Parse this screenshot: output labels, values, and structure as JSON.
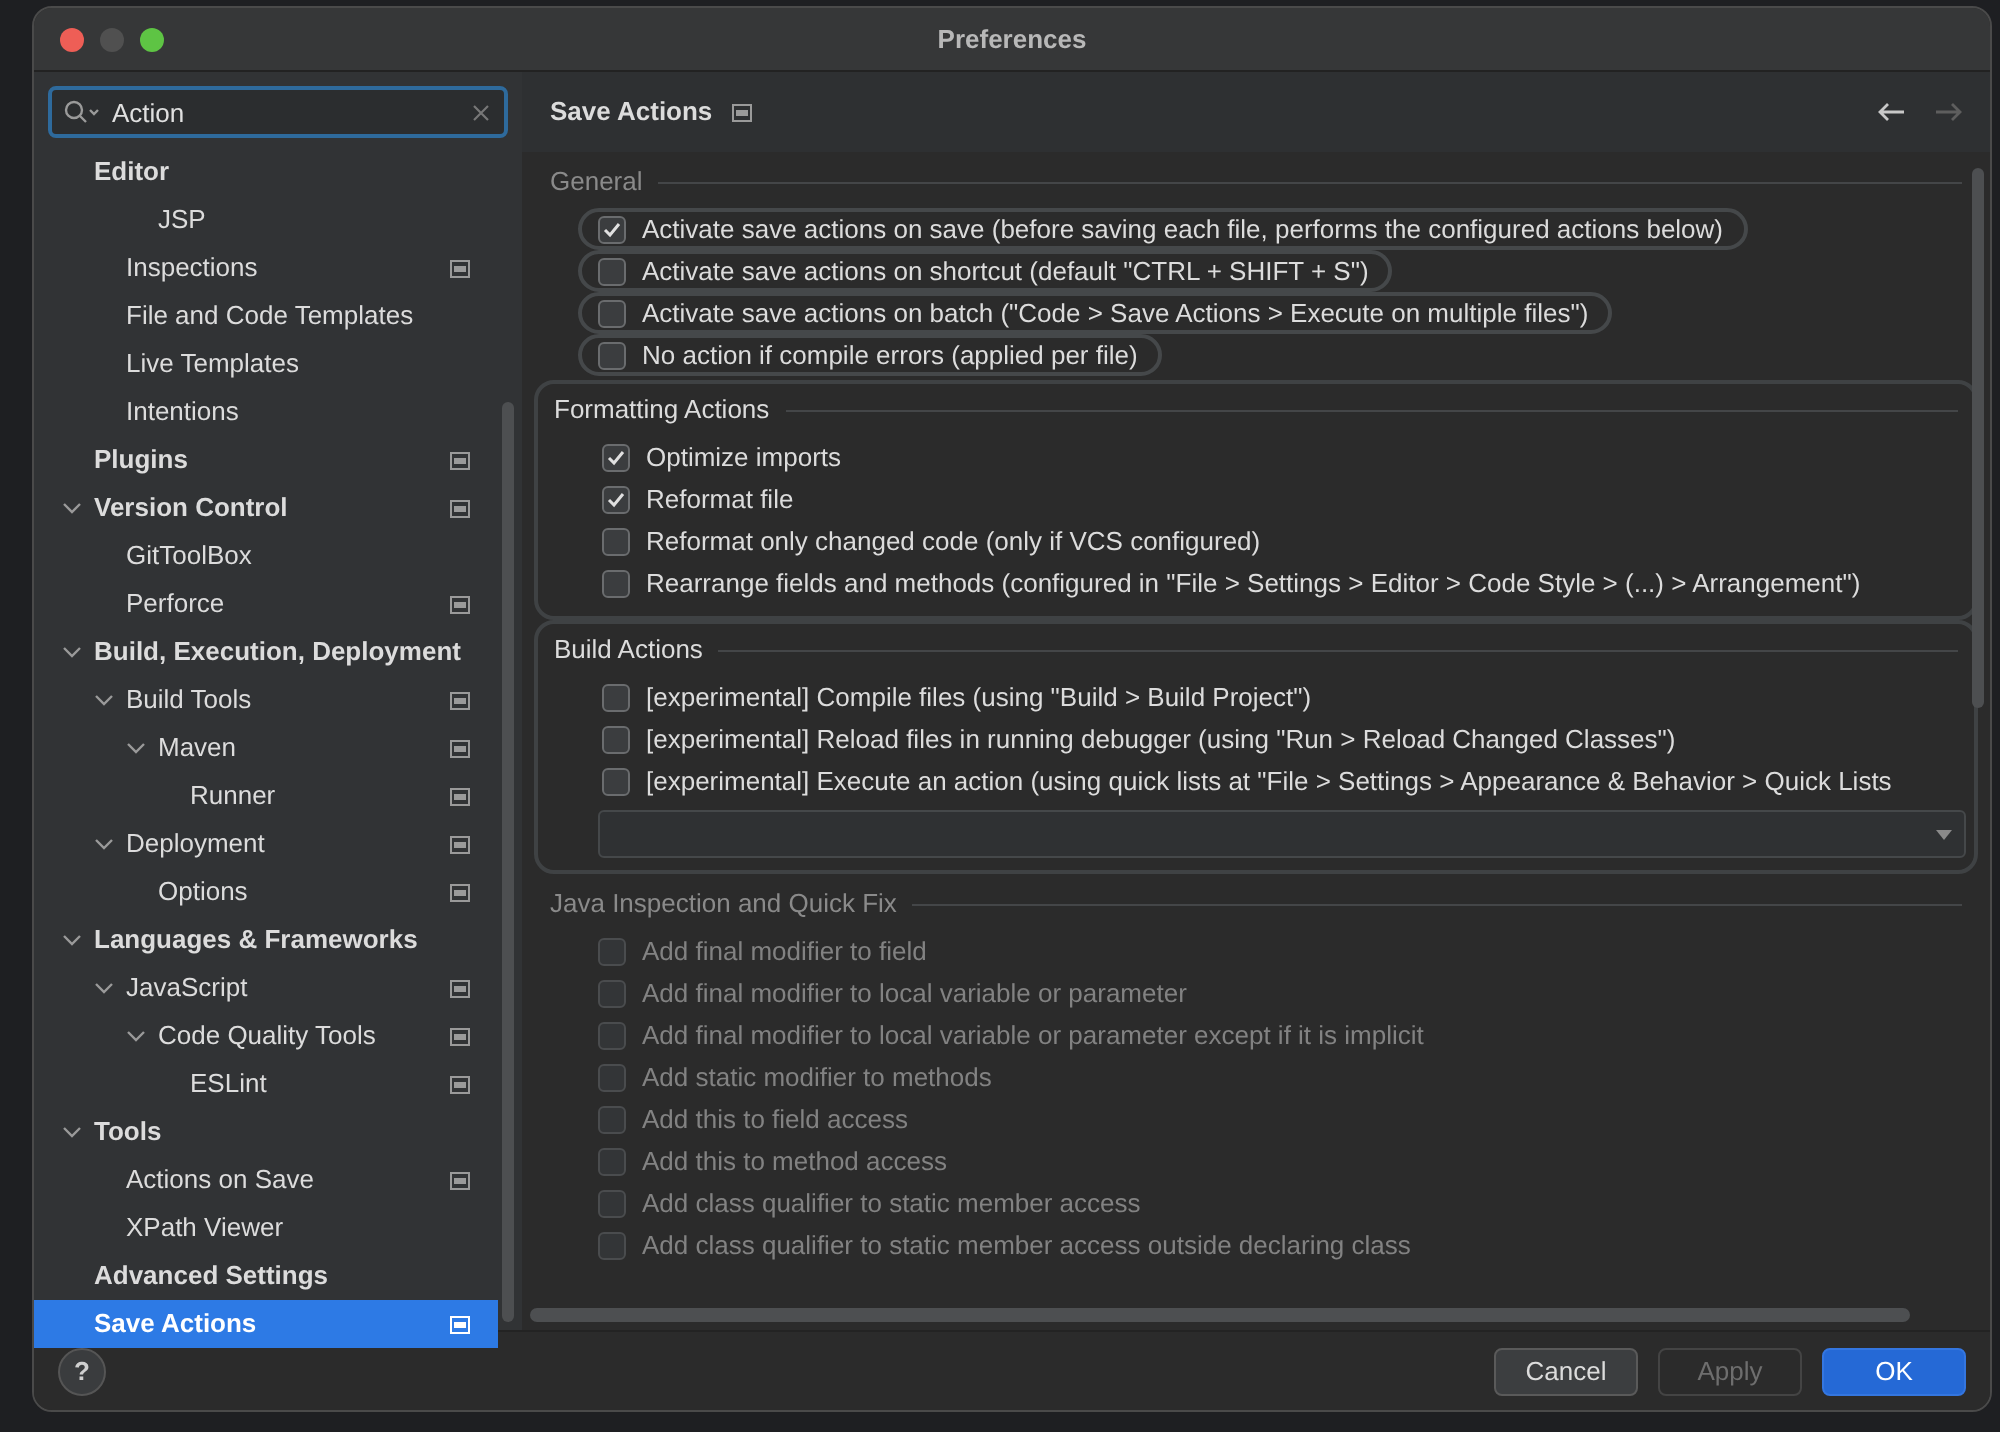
{
  "window": {
    "title": "Preferences"
  },
  "search": {
    "value": "Action"
  },
  "tree": [
    {
      "label": "Editor",
      "bold": true,
      "project_level": false,
      "selected": false,
      "children": [
        {
          "label": "JSP",
          "project_level": false,
          "selected": false,
          "indent_extra": true
        },
        {
          "label": "Inspections",
          "project_level": true,
          "selected": false
        },
        {
          "label": "File and Code Templates",
          "project_level": false,
          "selected": false
        },
        {
          "label": "Live Templates",
          "project_level": false,
          "selected": false
        },
        {
          "label": "Intentions",
          "project_level": false,
          "selected": false
        }
      ]
    },
    {
      "label": "Plugins",
      "bold": true,
      "project_level": true,
      "selected": false
    },
    {
      "label": "Version Control",
      "bold": true,
      "expanded": true,
      "project_level": true,
      "selected": false,
      "children": [
        {
          "label": "GitToolBox",
          "project_level": false,
          "selected": false
        },
        {
          "label": "Perforce",
          "project_level": true,
          "selected": false
        }
      ]
    },
    {
      "label": "Build, Execution, Deployment",
      "bold": true,
      "expanded": true,
      "project_level": false,
      "selected": false,
      "children": [
        {
          "label": "Build Tools",
          "expanded": true,
          "project_level": true,
          "selected": false,
          "children": [
            {
              "label": "Maven",
              "expanded": true,
              "project_level": true,
              "selected": false,
              "children": [
                {
                  "label": "Runner",
                  "project_level": true,
                  "selected": false
                }
              ]
            }
          ]
        },
        {
          "label": "Deployment",
          "expanded": true,
          "project_level": true,
          "selected": false,
          "children": [
            {
              "label": "Options",
              "project_level": true,
              "selected": false
            }
          ]
        }
      ]
    },
    {
      "label": "Languages & Frameworks",
      "bold": true,
      "expanded": true,
      "project_level": false,
      "selected": false,
      "children": [
        {
          "label": "JavaScript",
          "expanded": true,
          "project_level": true,
          "selected": false,
          "children": [
            {
              "label": "Code Quality Tools",
              "expanded": true,
              "project_level": true,
              "selected": false,
              "children": [
                {
                  "label": "ESLint",
                  "project_level": true,
                  "selected": false
                }
              ]
            }
          ]
        }
      ]
    },
    {
      "label": "Tools",
      "bold": true,
      "expanded": true,
      "project_level": false,
      "selected": false,
      "children": [
        {
          "label": "Actions on Save",
          "project_level": true,
          "selected": false
        },
        {
          "label": "XPath Viewer",
          "project_level": false,
          "selected": false
        }
      ]
    },
    {
      "label": "Advanced Settings",
      "bold": true,
      "project_level": false,
      "selected": false
    },
    {
      "label": "Save Actions",
      "bold": true,
      "project_level": true,
      "selected": true
    }
  ],
  "page": {
    "title": "Save Actions",
    "project_level": true
  },
  "sections": [
    {
      "title": "General",
      "highlighted": false,
      "items": [
        {
          "label": "Activate save actions on save (before saving each file, performs the configured actions below)",
          "checked": true,
          "highlighted": true,
          "disabled": false
        },
        {
          "label": "Activate save actions on shortcut (default \"CTRL + SHIFT + S\")",
          "checked": false,
          "highlighted": true,
          "disabled": false
        },
        {
          "label": "Activate save actions on batch (\"Code > Save Actions > Execute on multiple files\")",
          "checked": false,
          "highlighted": true,
          "disabled": false
        },
        {
          "label": "No action if compile errors (applied per file)",
          "checked": false,
          "highlighted": true,
          "disabled": false
        }
      ]
    },
    {
      "title": "Formatting Actions",
      "highlighted": true,
      "items": [
        {
          "label": "Optimize imports",
          "checked": true,
          "highlighted": false,
          "disabled": false
        },
        {
          "label": "Reformat file",
          "checked": true,
          "highlighted": false,
          "disabled": false
        },
        {
          "label": "Reformat only changed code (only if VCS configured)",
          "checked": false,
          "highlighted": false,
          "disabled": false
        },
        {
          "label": "Rearrange fields and methods (configured in \"File > Settings > Editor > Code Style > (...) > Arrangement\")",
          "checked": false,
          "highlighted": false,
          "disabled": false
        }
      ]
    },
    {
      "title": "Build Actions",
      "highlighted": true,
      "has_dropdown": true,
      "items": [
        {
          "label": "[experimental] Compile files (using \"Build > Build Project\")",
          "checked": false,
          "highlighted": false,
          "disabled": false
        },
        {
          "label": "[experimental] Reload files in running debugger (using \"Run > Reload Changed Classes\")",
          "checked": false,
          "highlighted": false,
          "disabled": false
        },
        {
          "label": "[experimental] Execute an action (using quick lists at \"File > Settings > Appearance & Behavior > Quick Lists",
          "checked": false,
          "highlighted": false,
          "disabled": false
        }
      ]
    },
    {
      "title": "Java Inspection and Quick Fix",
      "highlighted": false,
      "items": [
        {
          "label": "Add final modifier to field",
          "checked": false,
          "highlighted": false,
          "disabled": true
        },
        {
          "label": "Add final modifier to local variable or parameter",
          "checked": false,
          "highlighted": false,
          "disabled": true
        },
        {
          "label": "Add final modifier to local variable or parameter except if it is implicit",
          "checked": false,
          "highlighted": false,
          "disabled": true
        },
        {
          "label": "Add static modifier to methods",
          "checked": false,
          "highlighted": false,
          "disabled": true
        },
        {
          "label": "Add this to field access",
          "checked": false,
          "highlighted": false,
          "disabled": true
        },
        {
          "label": "Add this to method access",
          "checked": false,
          "highlighted": false,
          "disabled": true
        },
        {
          "label": "Add class qualifier to static member access",
          "checked": false,
          "highlighted": false,
          "disabled": true
        },
        {
          "label": "Add class qualifier to static member access outside declaring class",
          "checked": false,
          "highlighted": false,
          "disabled": true
        }
      ]
    }
  ],
  "help": {
    "label": "?"
  },
  "buttons": [
    {
      "label": "Cancel",
      "kind": "secondary",
      "disabled": false
    },
    {
      "label": "Apply",
      "kind": "secondary",
      "disabled": true
    },
    {
      "label": "OK",
      "kind": "primary",
      "disabled": false
    }
  ]
}
